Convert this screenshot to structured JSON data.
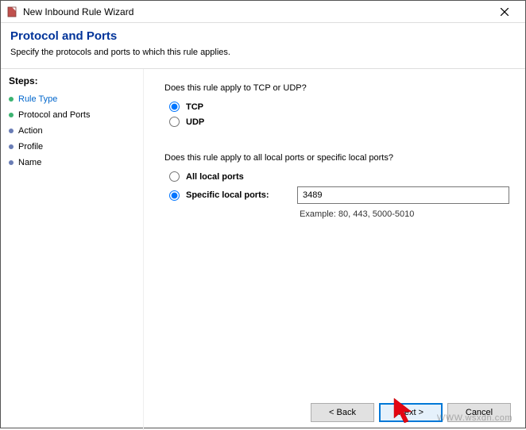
{
  "window": {
    "title": "New Inbound Rule Wizard"
  },
  "header": {
    "title": "Protocol and Ports",
    "subtitle": "Specify the protocols and ports to which this rule applies."
  },
  "sidebar": {
    "heading": "Steps:",
    "items": [
      {
        "label": "Rule Type"
      },
      {
        "label": "Protocol and Ports"
      },
      {
        "label": "Action"
      },
      {
        "label": "Profile"
      },
      {
        "label": "Name"
      }
    ]
  },
  "content": {
    "q1": "Does this rule apply to TCP or UDP?",
    "opt_tcp": "TCP",
    "opt_udp": "UDP",
    "q2": "Does this rule apply to all local ports or specific local ports?",
    "opt_all": "All local ports",
    "opt_specific": "Specific local ports:",
    "port_value": "3489",
    "example": "Example: 80, 443, 5000-5010"
  },
  "footer": {
    "back": "< Back",
    "next": "Next >",
    "cancel": "Cancel"
  },
  "watermark": "WWW.wsxdn.com"
}
